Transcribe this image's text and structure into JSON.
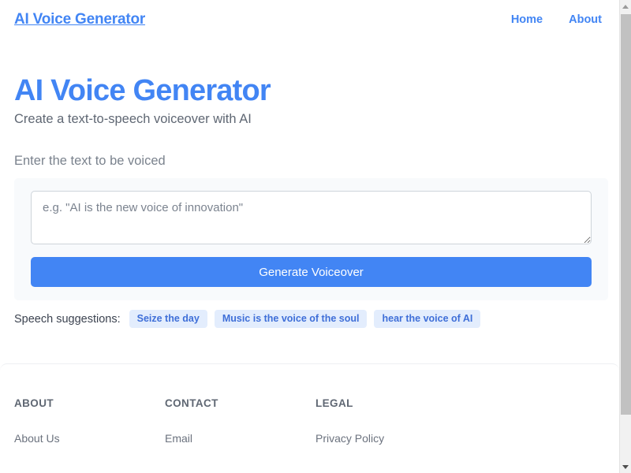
{
  "header": {
    "brand": "AI Voice Generator",
    "nav": [
      {
        "label": "Home"
      },
      {
        "label": "About"
      }
    ]
  },
  "hero": {
    "title": "AI Voice Generator",
    "subtitle": "Create a text-to-speech voiceover with AI"
  },
  "form": {
    "label": "Enter the text to be voiced",
    "textarea_value": "",
    "textarea_placeholder": "e.g. \"AI is the new voice of innovation\"",
    "submit_label": "Generate Voiceover"
  },
  "suggestions": {
    "label": "Speech suggestions:",
    "chips": [
      {
        "label": "Seize the day"
      },
      {
        "label": "Music is the voice of the soul"
      },
      {
        "label": "hear the voice of AI"
      }
    ]
  },
  "footer": {
    "columns": [
      {
        "heading": "ABOUT",
        "link": "About Us"
      },
      {
        "heading": "CONTACT",
        "link": "Email"
      },
      {
        "heading": "LEGAL",
        "link": "Privacy Policy"
      }
    ]
  },
  "colors": {
    "accent": "#4285f4",
    "chip_bg": "#e3edfd",
    "chip_text": "#3f6fd8",
    "panel_bg": "#f8fafc",
    "muted_text": "#6b727e"
  }
}
